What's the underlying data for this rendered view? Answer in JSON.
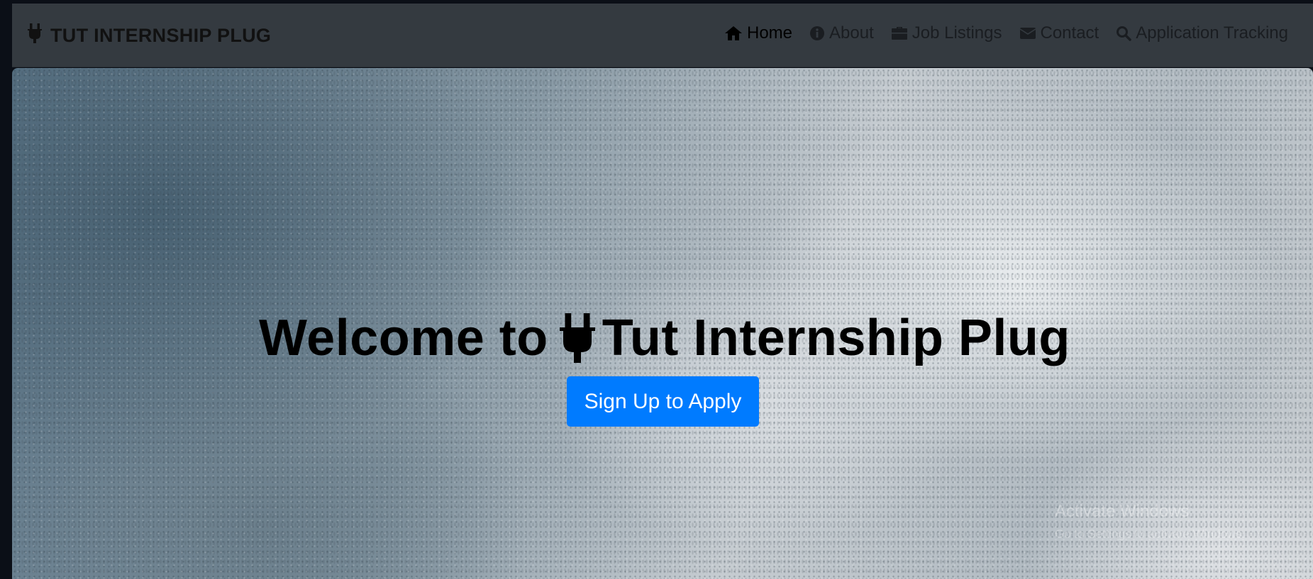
{
  "brand": {
    "icon": "plug-icon",
    "name": "TUT INTERNSHIP PLUG"
  },
  "nav": {
    "items": [
      {
        "icon": "home-icon",
        "label": "Home",
        "active": true
      },
      {
        "icon": "info-icon",
        "label": "About",
        "active": false
      },
      {
        "icon": "briefcase-icon",
        "label": "Job Listings",
        "active": false
      },
      {
        "icon": "envelope-icon",
        "label": "Contact",
        "active": false
      },
      {
        "icon": "search-icon",
        "label": "Application Tracking",
        "active": false
      }
    ]
  },
  "hero": {
    "title_prefix": "Welcome to",
    "title_icon": "plug-icon",
    "title_suffix": "Tut Internship Plug",
    "cta_label": "Sign Up to Apply"
  },
  "watermark": {
    "line1": "Activate Windows",
    "line2": "Go to Settings to activate Windows."
  },
  "colors": {
    "navbar_bg": "#343a40",
    "cta_bg": "#007bff",
    "cta_text": "#ffffff"
  }
}
